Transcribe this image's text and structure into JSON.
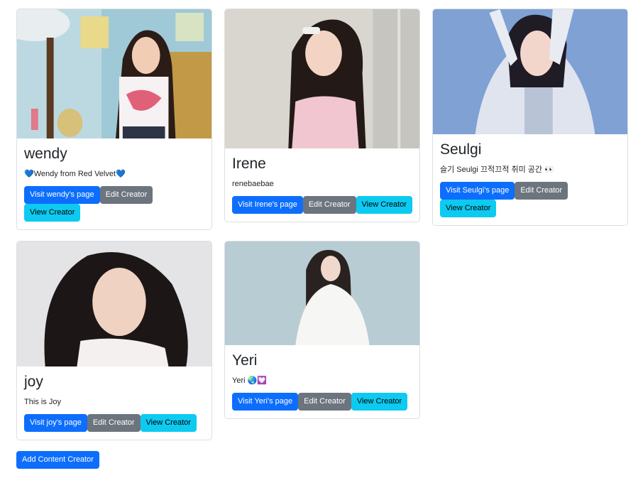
{
  "creators": [
    {
      "name": "wendy",
      "description": "💙Wendy from Red Velvet💙",
      "visit_label": "Visit wendy's page",
      "edit_label": "Edit Creator",
      "view_label": "View Creator"
    },
    {
      "name": "Irene",
      "description": "renebaebae",
      "visit_label": "Visit Irene's page",
      "edit_label": "Edit Creator",
      "view_label": "View Creator"
    },
    {
      "name": "Seulgi",
      "description": "슬기 Seulgi 끄적끄적 취미 공간 👀",
      "visit_label": "Visit Seulgi's page",
      "edit_label": "Edit Creator",
      "view_label": "View Creator"
    },
    {
      "name": "joy",
      "description": "This is Joy",
      "visit_label": "Visit joy's page",
      "edit_label": "Edit Creator",
      "view_label": "View Creator"
    },
    {
      "name": "Yeri",
      "description": "Yeri 🌏💟",
      "visit_label": "Visit Yeri's page",
      "edit_label": "Edit Creator",
      "view_label": "View Creator"
    }
  ],
  "add_label": "Add Content Creator",
  "colors": {
    "primary": "#0d6efd",
    "secondary": "#6c757d",
    "info": "#0dcaf0"
  }
}
